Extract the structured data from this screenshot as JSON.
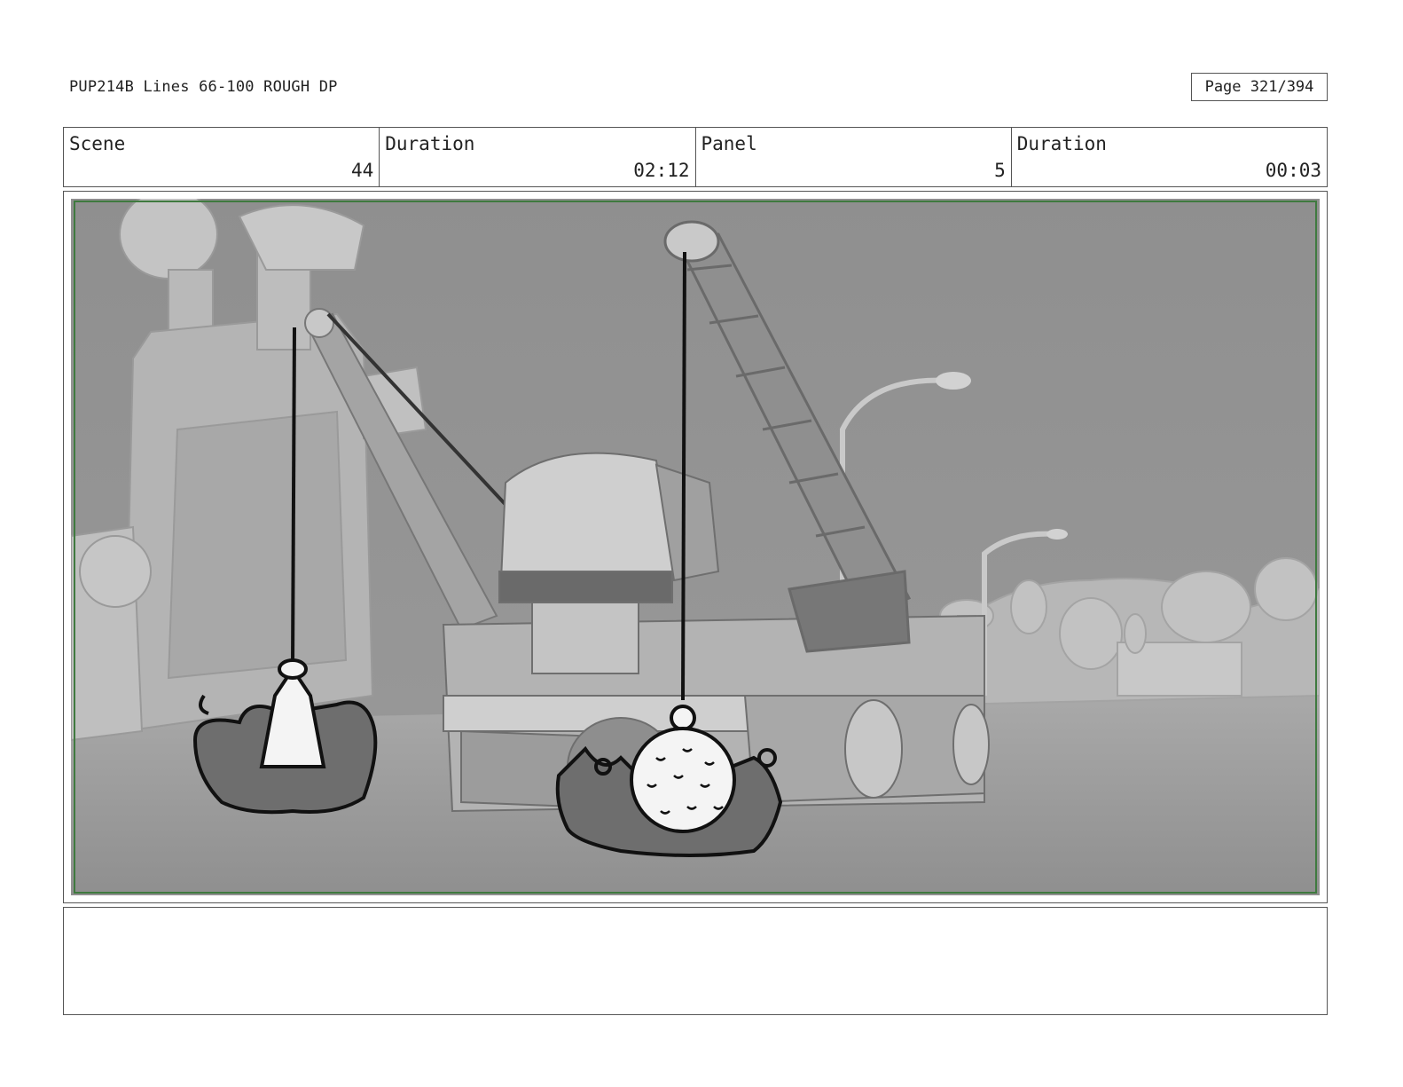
{
  "document": {
    "title": "PUP214B Lines 66-100 ROUGH DP",
    "page_label": "Page 321/394"
  },
  "info": {
    "scene_label": "Scene",
    "scene_value": "44",
    "scene_duration_label": "Duration",
    "scene_duration_value": "02:12",
    "panel_label": "Panel",
    "panel_value": "5",
    "panel_duration_label": "Duration",
    "panel_duration_value": "00:03"
  },
  "panel": {
    "frame_color": "#3f7a3f",
    "image_content": "grayscale 3D street scene with two crane machines and hand-drawn wrecking ball and claw impacts"
  },
  "notes": {
    "text": ""
  }
}
